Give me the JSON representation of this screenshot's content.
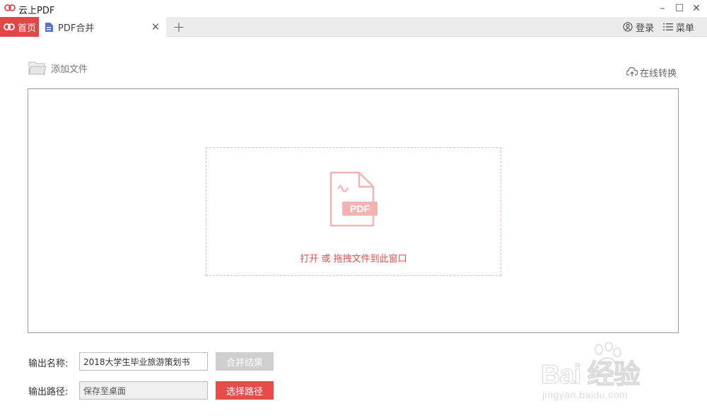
{
  "app": {
    "title": "云上PDF",
    "brand_color": "#e04848",
    "window_controls": {
      "minimize": "–",
      "maximize": "☐",
      "close": "✕"
    }
  },
  "tabs": {
    "home_label": "首页",
    "active_tab_label": "PDF合并",
    "close_symbol": "✕",
    "add_symbol": "+"
  },
  "header_right": {
    "login_label": "登录",
    "menu_label": "菜单"
  },
  "toolbar": {
    "add_file_label": "添加文件",
    "online_convert_label": "在线转换"
  },
  "drop_zone": {
    "icon_text": "PDF",
    "hint": "打开 或 拖拽文件到此窗口"
  },
  "form": {
    "output_name_label": "输出名称:",
    "output_name_value": "2018大学生毕业旅游策划书",
    "merge_button_label": "合并结果",
    "output_path_label": "输出路径:",
    "output_path_value": "保存至桌面",
    "choose_path_button_label": "选择路径"
  },
  "watermark": {
    "main": "Bai  经验",
    "sub": "jingyan.baidu.com"
  }
}
